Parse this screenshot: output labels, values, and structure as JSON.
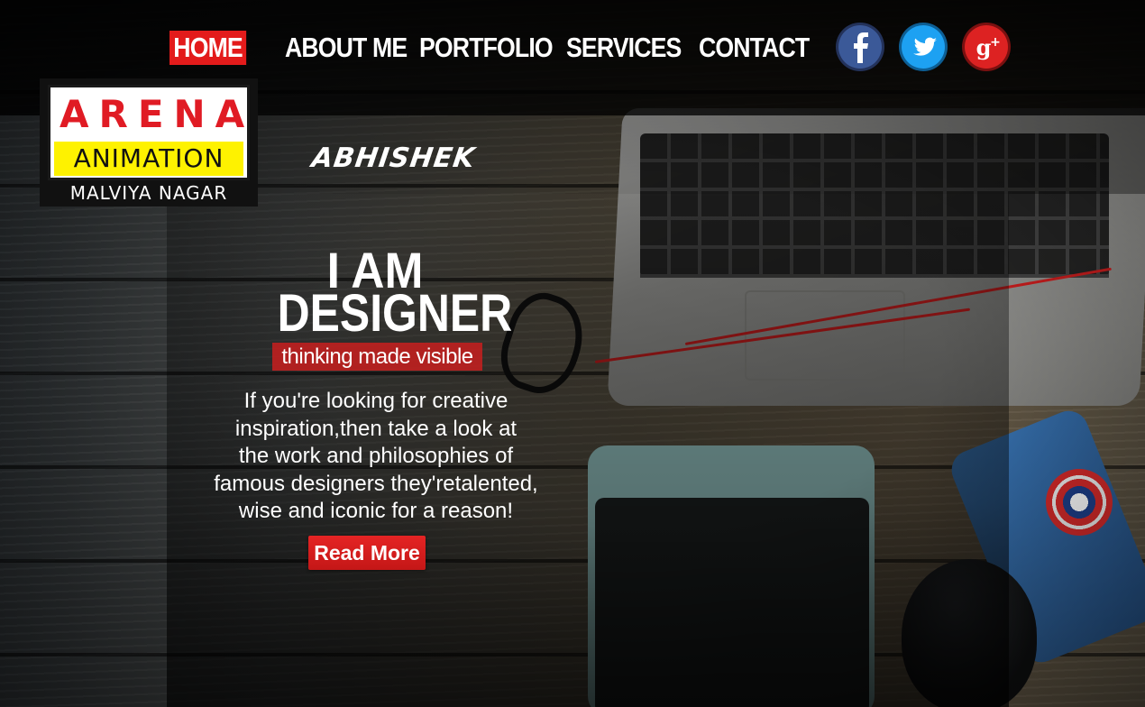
{
  "nav": {
    "items": [
      {
        "label": "HOME",
        "active": true
      },
      {
        "label": "ABOUT ME",
        "active": false
      },
      {
        "label": "PORTFOLIO",
        "active": false
      },
      {
        "label": "SERVICES",
        "active": false
      },
      {
        "label": "CONTACT",
        "active": false
      }
    ]
  },
  "social": [
    {
      "icon": "facebook-icon",
      "glyph": "f",
      "color": "#3b5998"
    },
    {
      "icon": "twitter-icon",
      "glyph": "bird",
      "color": "#1da1f2"
    },
    {
      "icon": "google-plus-icon",
      "glyph": "g+",
      "color": "#dd2222"
    }
  ],
  "logo": {
    "line1": "ARENA",
    "line2": "ANIMATION",
    "line3": "MALVIYA NAGAR"
  },
  "brand_name": "ABHISHEK",
  "hero": {
    "line1": "I AM",
    "line2": "DESIGNER",
    "tagline": "thinking made visible",
    "intro_lines": [
      "If you're looking for creative",
      "inspiration,then take a look at",
      "the work and philosophies of",
      "famous designers they'retalented,",
      "wise and iconic for a reason!"
    ],
    "cta_label": "Read More"
  },
  "colors": {
    "accent": "#e31b1b",
    "logo_red": "#e01b24",
    "logo_yellow": "#fef200"
  }
}
